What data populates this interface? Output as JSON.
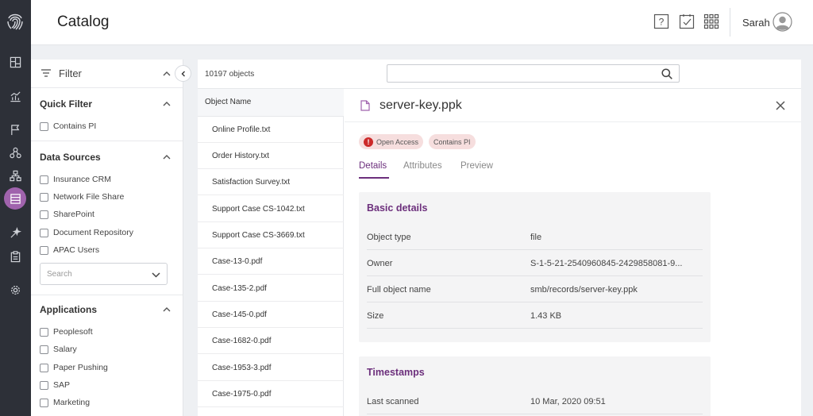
{
  "header": {
    "title": "Catalog",
    "user": "Sarah"
  },
  "rail": {
    "logo": "fingerprint-icon",
    "items": [
      "dashboard-icon",
      "analytics-icon",
      "flag-icon",
      "hierarchy-icon",
      "network-icon",
      "catalog-icon",
      "wand-icon",
      "clipboard-icon",
      "settings-icon"
    ],
    "active": "catalog-icon"
  },
  "filter": {
    "title": "Filter",
    "quick_filter": {
      "title": "Quick Filter",
      "items": [
        "Contains PI"
      ]
    },
    "data_sources": {
      "title": "Data Sources",
      "items": [
        "Insurance CRM",
        "Network File Share",
        "SharePoint",
        "Document Repository",
        "APAC Users"
      ],
      "search_placeholder": "Search"
    },
    "applications": {
      "title": "Applications",
      "items": [
        "Peoplesoft",
        "Salary",
        "Paper Pushing",
        "SAP",
        "Marketing"
      ]
    }
  },
  "list": {
    "count": "10197 objects",
    "column": "Object Name",
    "rows": [
      "Online Profile.txt",
      "Order History.txt",
      "Satisfaction Survey.txt",
      "Support Case CS-1042.txt",
      "Support Case CS-3669.txt",
      "Case-13-0.pdf",
      "Case-135-2.pdf",
      "Case-145-0.pdf",
      "Case-1682-0.pdf",
      "Case-1953-3.pdf",
      "Case-1975-0.pdf"
    ]
  },
  "detail": {
    "title": "server-key.ppk",
    "badges": [
      "Open Access",
      "Contains PI"
    ],
    "tabs": [
      "Details",
      "Attributes",
      "Preview"
    ],
    "active_tab": "Details",
    "basic": {
      "title": "Basic details",
      "rows": [
        {
          "k": "Object type",
          "v": "file"
        },
        {
          "k": "Owner",
          "v": "S-1-5-21-2540960845-2429858081-9..."
        },
        {
          "k": "Full object name",
          "v": "smb/records/server-key.ppk"
        },
        {
          "k": "Size",
          "v": "1.43 KB"
        }
      ]
    },
    "timestamps": {
      "title": "Timestamps",
      "rows": [
        {
          "k": "Last scanned",
          "v": "10 Mar, 2020 09:51"
        }
      ]
    }
  },
  "colors": {
    "accent": "#6c2f7c",
    "rail": "#2d3038",
    "active_rail": "#a063ad",
    "badge_bg": "#f6dede",
    "warn": "#cc2a2a"
  }
}
